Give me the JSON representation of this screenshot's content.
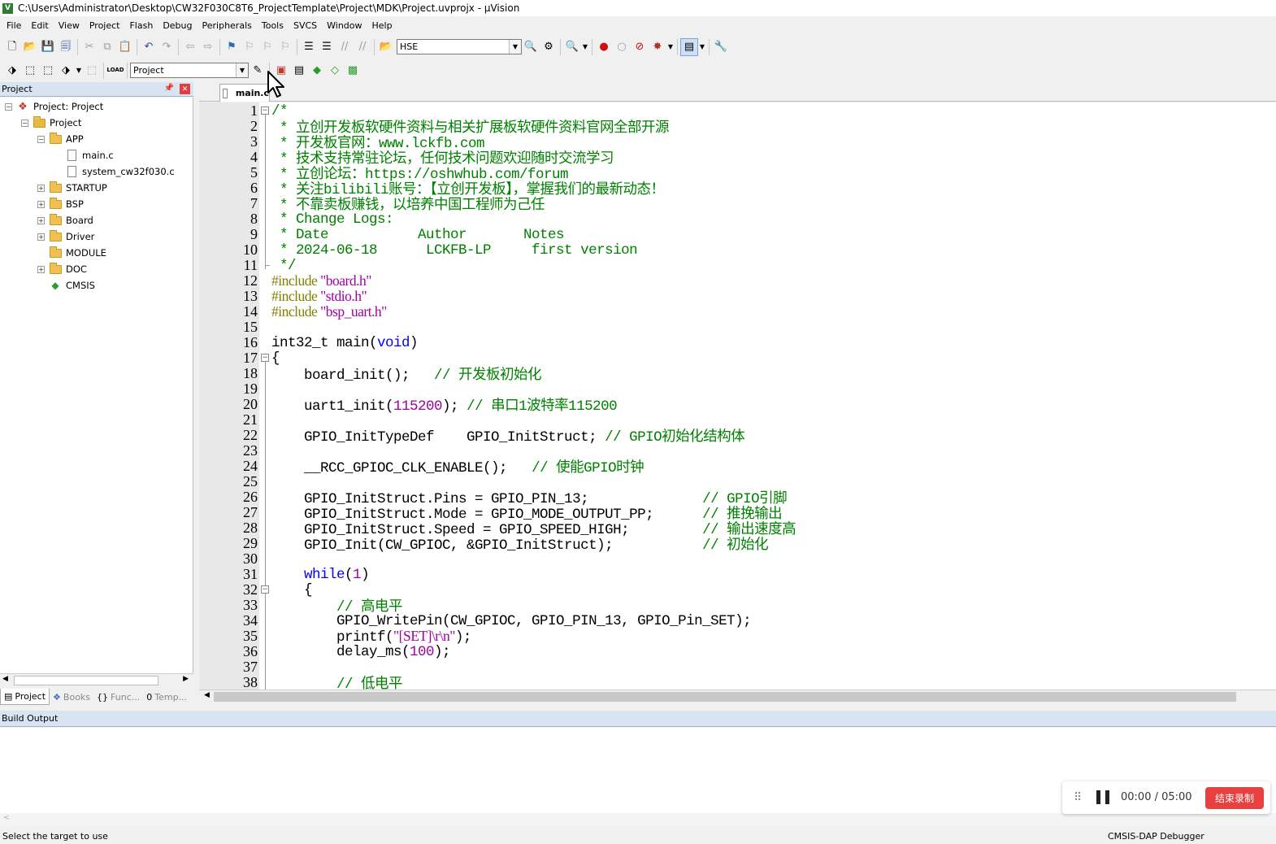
{
  "window": {
    "title": "C:\\Users\\Administrator\\Desktop\\CW32F030C8T6_ProjectTemplate\\Project\\MDK\\Project.uvprojx - µVision"
  },
  "menu": [
    "File",
    "Edit",
    "View",
    "Project",
    "Flash",
    "Debug",
    "Peripherals",
    "Tools",
    "SVCS",
    "Window",
    "Help"
  ],
  "toolbar": {
    "target_combo_value": "HSE",
    "project_combo_value": "Project"
  },
  "project_pane": {
    "title": "Project",
    "tree": [
      {
        "label": "Project: Project",
        "level": 0,
        "type": "root",
        "expanded": true
      },
      {
        "label": "Project",
        "level": 1,
        "type": "target",
        "expanded": true
      },
      {
        "label": "APP",
        "level": 2,
        "type": "folder",
        "expanded": true
      },
      {
        "label": "main.c",
        "level": 3,
        "type": "file"
      },
      {
        "label": "system_cw32f030.c",
        "level": 3,
        "type": "file"
      },
      {
        "label": "STARTUP",
        "level": 2,
        "type": "folder",
        "expanded": false
      },
      {
        "label": "BSP",
        "level": 2,
        "type": "folder",
        "expanded": false
      },
      {
        "label": "Board",
        "level": 2,
        "type": "folder",
        "expanded": false
      },
      {
        "label": "Driver",
        "level": 2,
        "type": "folder",
        "expanded": false
      },
      {
        "label": "MODULE",
        "level": 2,
        "type": "folder",
        "leaf": true
      },
      {
        "label": "DOC",
        "level": 2,
        "type": "folder",
        "expanded": false
      },
      {
        "label": "CMSIS",
        "level": 2,
        "type": "cmsis",
        "leaf": true
      }
    ],
    "tabs": [
      "Project",
      "Books",
      "Func...",
      "Temp..."
    ]
  },
  "editor": {
    "tab_label": "main.c",
    "lines": [
      {
        "n": "1",
        "fold": "open",
        "segs": [
          {
            "t": "/*",
            "c": "com"
          }
        ]
      },
      {
        "n": "2",
        "segs": [
          {
            "t": " * 立创开发板软硬件资料与相关扩展板软硬件资料官网全部开源",
            "c": "com"
          }
        ]
      },
      {
        "n": "3",
        "segs": [
          {
            "t": " * 开发板官网：www.lckfb.com",
            "c": "com"
          }
        ]
      },
      {
        "n": "4",
        "segs": [
          {
            "t": " * 技术支持常驻论坛，任何技术问题欢迎随时交流学习",
            "c": "com"
          }
        ]
      },
      {
        "n": "5",
        "segs": [
          {
            "t": " * 立创论坛：https://oshwhub.com/forum",
            "c": "com"
          }
        ]
      },
      {
        "n": "6",
        "segs": [
          {
            "t": " * 关注bilibili账号：【立创开发板】，掌握我们的最新动态！",
            "c": "com"
          }
        ]
      },
      {
        "n": "7",
        "segs": [
          {
            "t": " * 不靠卖板赚钱，以培养中国工程师为己任",
            "c": "com"
          }
        ]
      },
      {
        "n": "8",
        "segs": [
          {
            "t": " * Change Logs:",
            "c": "com"
          }
        ]
      },
      {
        "n": "9",
        "segs": [
          {
            "t": " * Date           Author       Notes",
            "c": "com"
          }
        ]
      },
      {
        "n": "10",
        "segs": [
          {
            "t": " * 2024-06-18      LCKFB-LP     first version",
            "c": "com"
          }
        ]
      },
      {
        "n": "11",
        "fold": "end",
        "segs": [
          {
            "t": " */",
            "c": "com"
          }
        ]
      },
      {
        "n": "12",
        "segs": [
          {
            "t": "#include ",
            "c": "pp"
          },
          {
            "t": "\"board.h\"",
            "c": "str"
          }
        ]
      },
      {
        "n": "13",
        "segs": [
          {
            "t": "#include ",
            "c": "pp"
          },
          {
            "t": "\"stdio.h\"",
            "c": "str"
          }
        ]
      },
      {
        "n": "14",
        "segs": [
          {
            "t": "#include ",
            "c": "pp"
          },
          {
            "t": "\"bsp_uart.h\"",
            "c": "str"
          }
        ]
      },
      {
        "n": "15",
        "segs": []
      },
      {
        "n": "16",
        "segs": [
          {
            "t": "int32_t main(",
            "c": ""
          },
          {
            "t": "void",
            "c": "kw"
          },
          {
            "t": ")",
            "c": ""
          }
        ]
      },
      {
        "n": "17",
        "fold": "open",
        "segs": [
          {
            "t": "{",
            "c": ""
          }
        ]
      },
      {
        "n": "18",
        "segs": [
          {
            "t": "    board_init();   ",
            "c": ""
          },
          {
            "t": "// 开发板初始化",
            "c": "com"
          }
        ]
      },
      {
        "n": "19",
        "segs": []
      },
      {
        "n": "20",
        "segs": [
          {
            "t": "    uart1_init(",
            "c": ""
          },
          {
            "t": "115200",
            "c": "num"
          },
          {
            "t": "); ",
            "c": ""
          },
          {
            "t": "// 串口1波特率115200",
            "c": "com"
          }
        ]
      },
      {
        "n": "21",
        "segs": []
      },
      {
        "n": "22",
        "segs": [
          {
            "t": "    GPIO_InitTypeDef    GPIO_InitStruct; ",
            "c": ""
          },
          {
            "t": "// GPIO初始化结构体",
            "c": "com"
          }
        ]
      },
      {
        "n": "23",
        "segs": []
      },
      {
        "n": "24",
        "segs": [
          {
            "t": "    __RCC_GPIOC_CLK_ENABLE();   ",
            "c": ""
          },
          {
            "t": "// 使能GPIO时钟",
            "c": "com"
          }
        ]
      },
      {
        "n": "25",
        "segs": []
      },
      {
        "n": "26",
        "segs": [
          {
            "t": "    GPIO_InitStruct.Pins = GPIO_PIN_13;              ",
            "c": ""
          },
          {
            "t": "// GPIO引脚",
            "c": "com"
          }
        ]
      },
      {
        "n": "27",
        "segs": [
          {
            "t": "    GPIO_InitStruct.Mode = GPIO_MODE_OUTPUT_PP;      ",
            "c": ""
          },
          {
            "t": "// 推挽输出",
            "c": "com"
          }
        ]
      },
      {
        "n": "28",
        "segs": [
          {
            "t": "    GPIO_InitStruct.Speed = GPIO_SPEED_HIGH;         ",
            "c": ""
          },
          {
            "t": "// 输出速度高",
            "c": "com"
          }
        ]
      },
      {
        "n": "29",
        "segs": [
          {
            "t": "    GPIO_Init(CW_GPIOC, &GPIO_InitStruct);           ",
            "c": ""
          },
          {
            "t": "// 初始化",
            "c": "com"
          }
        ]
      },
      {
        "n": "30",
        "segs": []
      },
      {
        "n": "31",
        "segs": [
          {
            "t": "    ",
            "c": ""
          },
          {
            "t": "while",
            "c": "kw"
          },
          {
            "t": "(",
            "c": ""
          },
          {
            "t": "1",
            "c": "num"
          },
          {
            "t": ")",
            "c": ""
          }
        ]
      },
      {
        "n": "32",
        "fold": "open",
        "segs": [
          {
            "t": "    {",
            "c": ""
          }
        ]
      },
      {
        "n": "33",
        "segs": [
          {
            "t": "        ",
            "c": ""
          },
          {
            "t": "// 高电平",
            "c": "com"
          }
        ]
      },
      {
        "n": "34",
        "segs": [
          {
            "t": "        GPIO_WritePin(CW_GPIOC, GPIO_PIN_13, GPIO_Pin_SET);",
            "c": ""
          }
        ]
      },
      {
        "n": "35",
        "segs": [
          {
            "t": "        printf(",
            "c": ""
          },
          {
            "t": "\"[SET]\\r\\n\"",
            "c": "str"
          },
          {
            "t": ");",
            "c": ""
          }
        ]
      },
      {
        "n": "36",
        "segs": [
          {
            "t": "        delay_ms(",
            "c": ""
          },
          {
            "t": "100",
            "c": "num"
          },
          {
            "t": ");",
            "c": ""
          }
        ]
      },
      {
        "n": "37",
        "segs": []
      },
      {
        "n": "38",
        "segs": [
          {
            "t": "        ",
            "c": ""
          },
          {
            "t": "// 低电平",
            "c": "com"
          }
        ]
      }
    ]
  },
  "build_output": {
    "title": "Build Output"
  },
  "statusbar": {
    "left": "Select the target to use",
    "right": "CMSIS-DAP Debugger"
  },
  "recorder": {
    "timer": "00:00 / 05:00",
    "stop_label": "结束录制"
  },
  "colors": {
    "comment": "#008000",
    "preprocessor": "#808000",
    "string": "#a000a0",
    "keyword": "#0000ff",
    "record_button": "#e84040"
  }
}
